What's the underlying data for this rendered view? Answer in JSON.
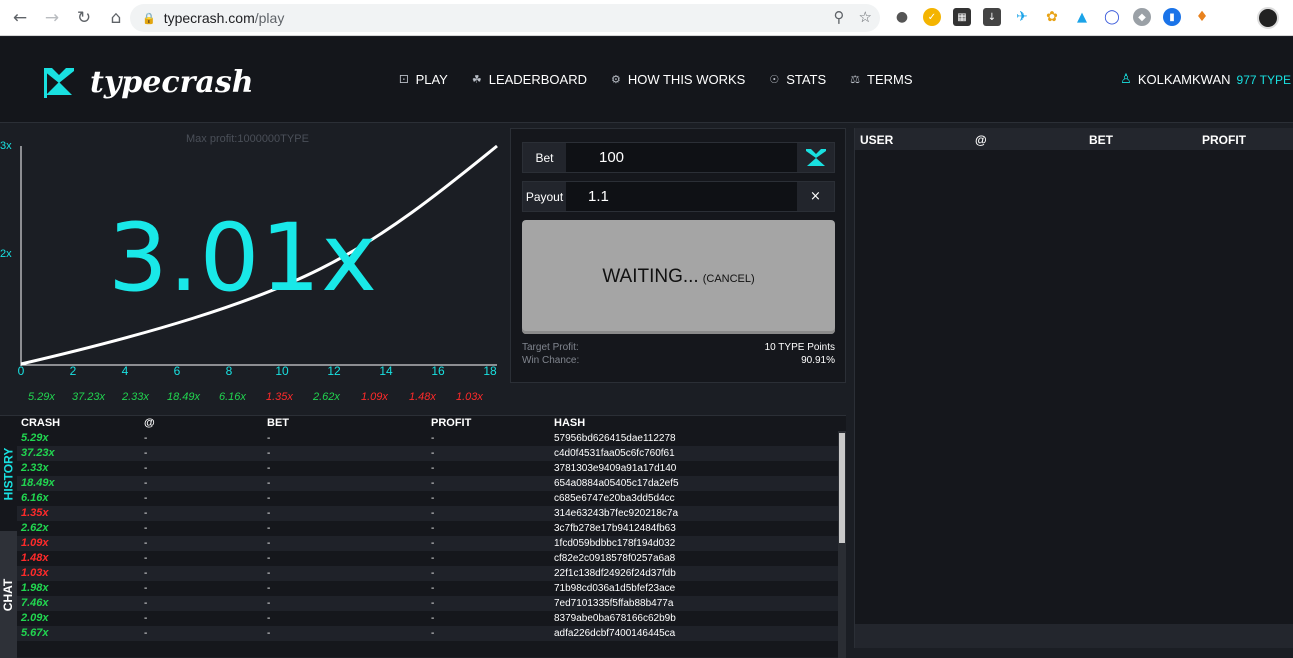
{
  "browser": {
    "url_host": "typecrash.com",
    "url_path": "/play",
    "back_icon": "arrow-left-icon",
    "forward_icon": "arrow-right-icon",
    "reload_icon": "reload-icon",
    "home_icon": "home-icon"
  },
  "header": {
    "logo_text": "typecrash",
    "nav": [
      {
        "label": "PLAY",
        "icon": "dice-icon"
      },
      {
        "label": "LEADERBOARD",
        "icon": "trophy-icon"
      },
      {
        "label": "HOW THIS WORKS",
        "icon": "gear-icon"
      },
      {
        "label": "STATS",
        "icon": "eye-icon"
      },
      {
        "label": "TERMS",
        "icon": "gavel-icon"
      }
    ],
    "username": "KOLKAMKWAN",
    "balance": "977 TYPE",
    "accent_color": "#19e0e0"
  },
  "graph": {
    "max_profit": "Max profit:1000000TYPE",
    "multiplier": "3.01x",
    "y_labels": [
      "3x",
      "2x"
    ],
    "x_ticks": [
      "0",
      "2",
      "4",
      "6",
      "8",
      "10",
      "12",
      "14",
      "16",
      "18"
    ],
    "recent_crashes": [
      {
        "value": "5.29x",
        "color": "green"
      },
      {
        "value": "37.23x",
        "color": "green"
      },
      {
        "value": "2.33x",
        "color": "green"
      },
      {
        "value": "18.49x",
        "color": "green"
      },
      {
        "value": "6.16x",
        "color": "green"
      },
      {
        "value": "1.35x",
        "color": "red"
      },
      {
        "value": "2.62x",
        "color": "green"
      },
      {
        "value": "1.09x",
        "color": "red"
      },
      {
        "value": "1.48x",
        "color": "red"
      },
      {
        "value": "1.03x",
        "color": "red"
      }
    ]
  },
  "bet_panel": {
    "bet_label": "Bet",
    "bet_value": "100",
    "payout_label": "Payout",
    "payout_value": "1.1",
    "clear_symbol": "×",
    "waiting_label": "WAITING...",
    "cancel_label": "(CANCEL)",
    "target_profit_label": "Target Profit:",
    "target_profit_value": "10 TYPE Points",
    "win_chance_label": "Win Chance:",
    "win_chance_value": "90.91%"
  },
  "players_table": {
    "columns": [
      "USER",
      "@",
      "BET",
      "PROFIT"
    ]
  },
  "history": {
    "tab_history": "HISTORY",
    "tab_chat": "CHAT",
    "columns": [
      "CRASH",
      "@",
      "BET",
      "PROFIT",
      "HASH"
    ],
    "rows": [
      {
        "crash": "5.29x",
        "color": "green",
        "at": "-",
        "bet": "-",
        "profit": "-",
        "hash": "57956bd626415dae112278"
      },
      {
        "crash": "37.23x",
        "color": "green",
        "at": "-",
        "bet": "-",
        "profit": "-",
        "hash": "c4d0f4531faa05c6fc760f61"
      },
      {
        "crash": "2.33x",
        "color": "green",
        "at": "-",
        "bet": "-",
        "profit": "-",
        "hash": "3781303e9409a91a17d140"
      },
      {
        "crash": "18.49x",
        "color": "green",
        "at": "-",
        "bet": "-",
        "profit": "-",
        "hash": "654a0884a05405c17da2ef5"
      },
      {
        "crash": "6.16x",
        "color": "green",
        "at": "-",
        "bet": "-",
        "profit": "-",
        "hash": "c685e6747e20ba3dd5d4cc"
      },
      {
        "crash": "1.35x",
        "color": "red",
        "at": "-",
        "bet": "-",
        "profit": "-",
        "hash": "314e63243b7fec920218c7a"
      },
      {
        "crash": "2.62x",
        "color": "green",
        "at": "-",
        "bet": "-",
        "profit": "-",
        "hash": "3c7fb278e17b9412484fb63"
      },
      {
        "crash": "1.09x",
        "color": "red",
        "at": "-",
        "bet": "-",
        "profit": "-",
        "hash": "1fcd059bdbbc178f194d032"
      },
      {
        "crash": "1.48x",
        "color": "red",
        "at": "-",
        "bet": "-",
        "profit": "-",
        "hash": "cf82e2c0918578f0257a6a8"
      },
      {
        "crash": "1.03x",
        "color": "red",
        "at": "-",
        "bet": "-",
        "profit": "-",
        "hash": "22f1c138df24926f24d37fdb"
      },
      {
        "crash": "1.98x",
        "color": "green",
        "at": "-",
        "bet": "-",
        "profit": "-",
        "hash": "71b98cd036a1d5bfef23ace"
      },
      {
        "crash": "7.46x",
        "color": "green",
        "at": "-",
        "bet": "-",
        "profit": "-",
        "hash": "7ed7101335f5ffab88b477a"
      },
      {
        "crash": "2.09x",
        "color": "green",
        "at": "-",
        "bet": "-",
        "profit": "-",
        "hash": "8379abe0ba678166c62b9b"
      },
      {
        "crash": "5.67x",
        "color": "green",
        "at": "-",
        "bet": "-",
        "profit": "-",
        "hash": "adfa226dcbf7400146445ca"
      }
    ]
  }
}
